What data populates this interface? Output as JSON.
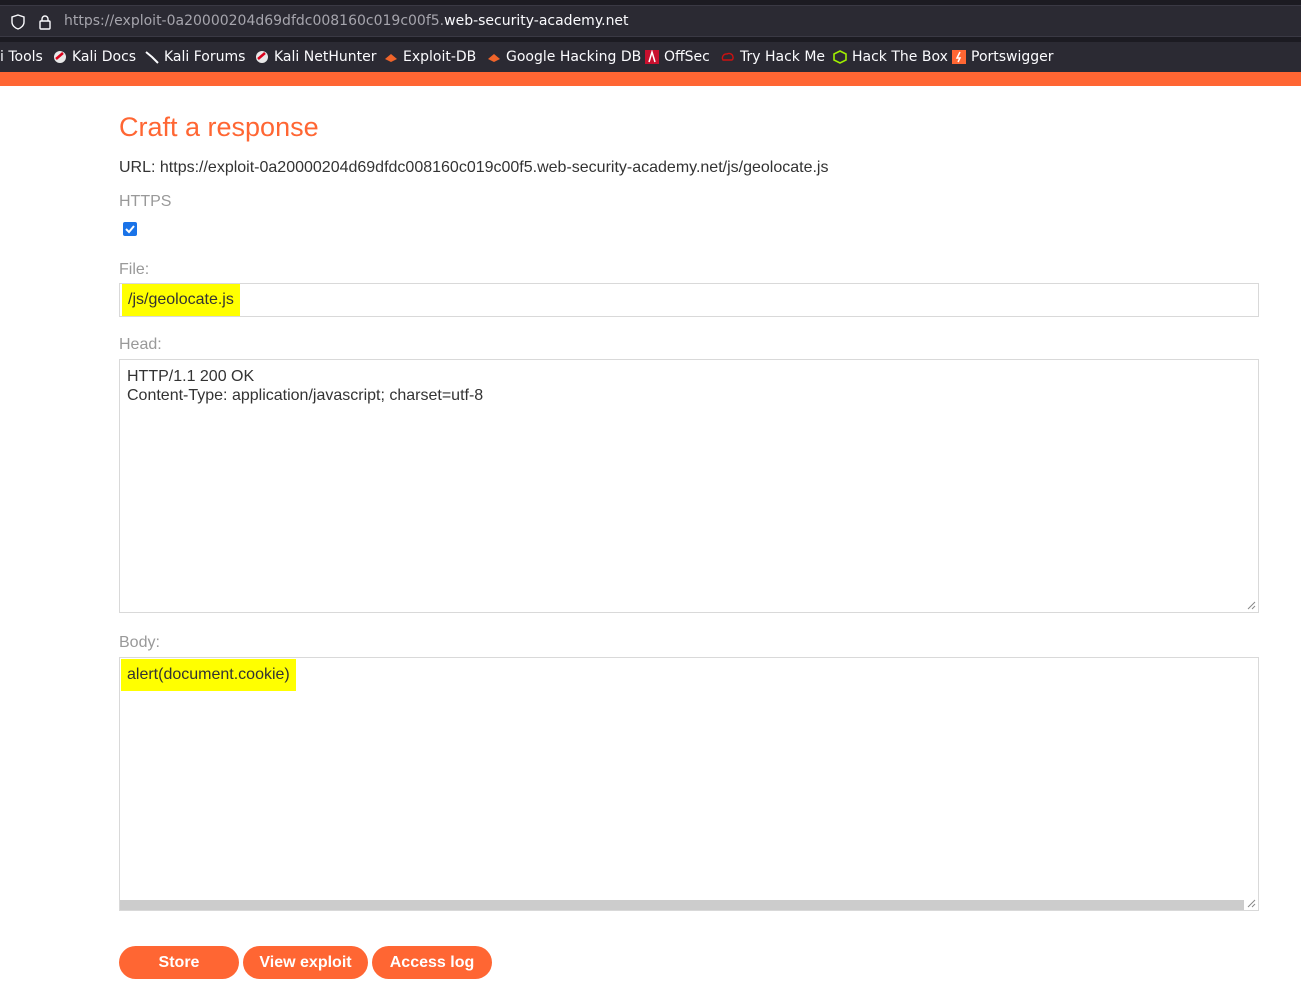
{
  "browser": {
    "url_dim": "https://exploit-0a20000204d69dfdc008160c019c00f5.",
    "url_domain": "web-security-academy.net",
    "bookmarks": [
      {
        "label": "i Tools",
        "icon": "kali-tools-icon"
      },
      {
        "label": "Kali Docs",
        "icon": "kali-docs-icon"
      },
      {
        "label": "Kali Forums",
        "icon": "kali-forums-icon"
      },
      {
        "label": "Kali NetHunter",
        "icon": "kali-nethunter-icon"
      },
      {
        "label": "Exploit-DB",
        "icon": "exploit-db-icon"
      },
      {
        "label": "Google Hacking DB",
        "icon": "google-hacking-db-icon"
      },
      {
        "label": "OffSec",
        "icon": "offsec-icon"
      },
      {
        "label": "Try Hack Me",
        "icon": "tryhackme-icon"
      },
      {
        "label": "Hack The Box",
        "icon": "hackthebox-icon"
      },
      {
        "label": "Portswigger",
        "icon": "portswigger-icon"
      }
    ]
  },
  "page": {
    "title": "Craft a response",
    "url_line": "URL: https://exploit-0a20000204d69dfdc008160c019c00f5.web-security-academy.net/js/geolocate.js",
    "https_label": "HTTPS",
    "https_checked": true,
    "file_label": "File:",
    "file_value": "/js/geolocate.js",
    "head_label": "Head:",
    "head_value": "HTTP/1.1 200 OK\nContent-Type: application/javascript; charset=utf-8",
    "body_label": "Body:",
    "body_value": "alert(document.cookie)"
  },
  "buttons": {
    "store": "Store",
    "view_exploit": "View exploit",
    "access_log": "Access log"
  },
  "colors": {
    "accent": "#ff6633",
    "highlight": "#ffff00",
    "checkbox": "#1a73e8"
  }
}
